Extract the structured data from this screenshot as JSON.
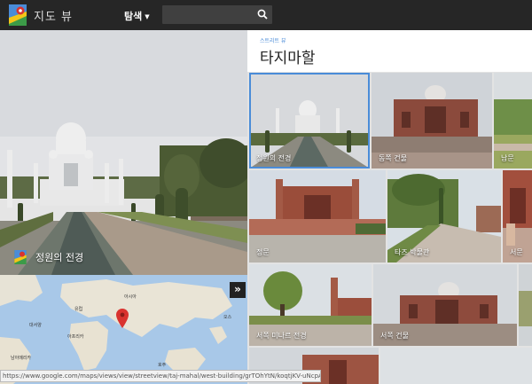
{
  "topbar": {
    "brand": "지도 뷰",
    "explore_label": "탐색",
    "search_placeholder": ""
  },
  "hero": {
    "caption": "정원의 전경"
  },
  "map": {
    "labels": [
      "아시아",
      "유럽",
      "아프리카",
      "대서양",
      "남아메리카",
      "오스",
      "호주"
    ],
    "expand_label": "»"
  },
  "status_url": "https://www.google.com/maps/views/view/streetview/taj-mahal/west-building/grTOhYtN/koqtjKV-uNcpA",
  "panel": {
    "kicker": "스트리트 뷰",
    "title": "타지마할"
  },
  "tiles": [
    {
      "label": "정원의 전경"
    },
    {
      "label": "동쪽 건물"
    },
    {
      "label": "남문"
    },
    {
      "label": "정문"
    },
    {
      "label": "타즈 박물관"
    },
    {
      "label": "서문"
    },
    {
      "label": "서쪽 미나르 전경"
    },
    {
      "label": "서쪽 건물"
    },
    {
      "label": ""
    },
    {
      "label": ""
    },
    {
      "label": ""
    }
  ],
  "colors": {
    "topbar": "#262626",
    "accent": "#4a8cd8",
    "map_water": "#a8c8e8",
    "marker": "#d9332f"
  }
}
